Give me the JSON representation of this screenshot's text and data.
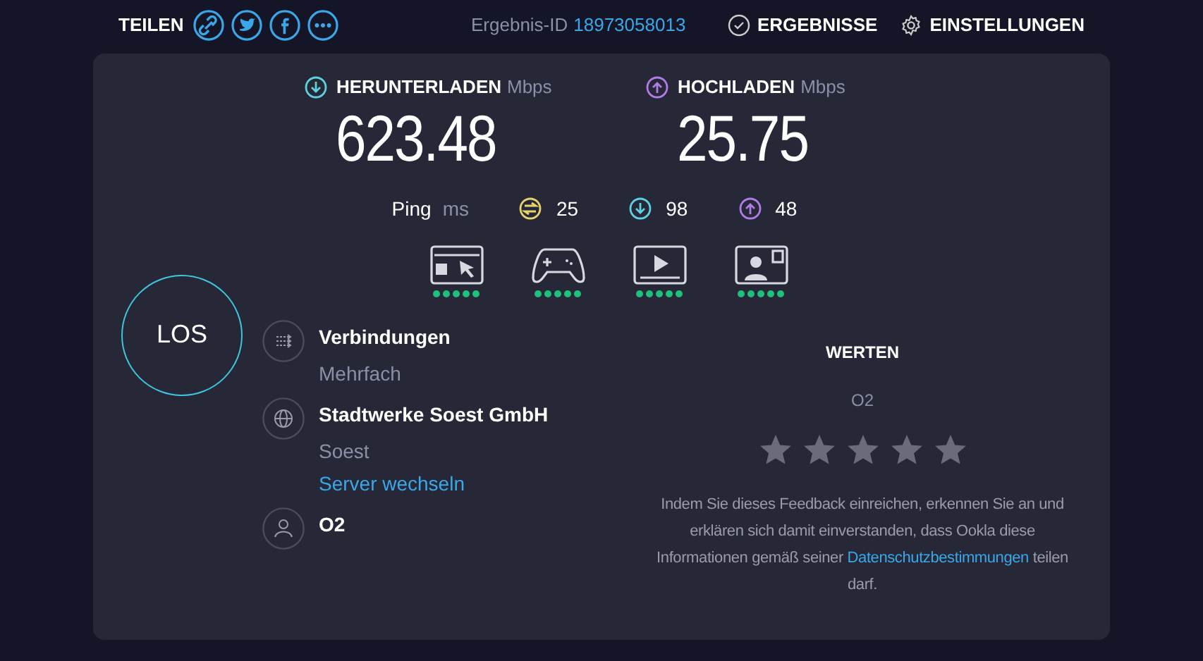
{
  "header": {
    "share_label": "TEILEN",
    "share_icons": [
      {
        "kind": "link"
      },
      {
        "kind": "twitter"
      },
      {
        "kind": "facebook"
      },
      {
        "kind": "more"
      }
    ],
    "result_label": "Ergebnis-ID",
    "result_id": "18973058013",
    "results_button": "ERGEBNISSE",
    "settings_button": "EINSTELLUNGEN"
  },
  "speeds": [
    {
      "kind": "download",
      "label": "HERUNTERLADEN",
      "unit": "Mbps",
      "value": "623.48"
    },
    {
      "kind": "upload",
      "label": "HOCHLADEN",
      "unit": "Mbps",
      "value": "25.75"
    }
  ],
  "ping": {
    "label": "Ping",
    "unit": "ms",
    "readings": [
      {
        "kind": "idle",
        "value": "25"
      },
      {
        "kind": "download",
        "value": "98"
      },
      {
        "kind": "upload",
        "value": "48"
      }
    ]
  },
  "quality": [
    {
      "kind": "browsing",
      "stars": 5
    },
    {
      "kind": "gaming",
      "stars": 5
    },
    {
      "kind": "video",
      "stars": 5
    },
    {
      "kind": "call",
      "stars": 5
    }
  ],
  "go_button": "LOS",
  "info": [
    {
      "kind": "connections",
      "title": "Verbindungen",
      "subtitle": "Mehrfach"
    },
    {
      "kind": "server",
      "title": "Stadtwerke Soest GmbH",
      "subtitle": "Soest",
      "link": "Server wechseln"
    },
    {
      "kind": "provider",
      "title": "O2"
    }
  ],
  "rating": {
    "title": "WERTEN",
    "provider": "O2",
    "stars": 0,
    "note_before": "Indem Sie dieses Feedback einreichen, erkennen Sie an und erklären sich damit einverstanden, dass Ookla diese Informationen gemäß seiner",
    "note_link": "Datenschutzbestimmungen",
    "note_after": "teilen darf."
  }
}
